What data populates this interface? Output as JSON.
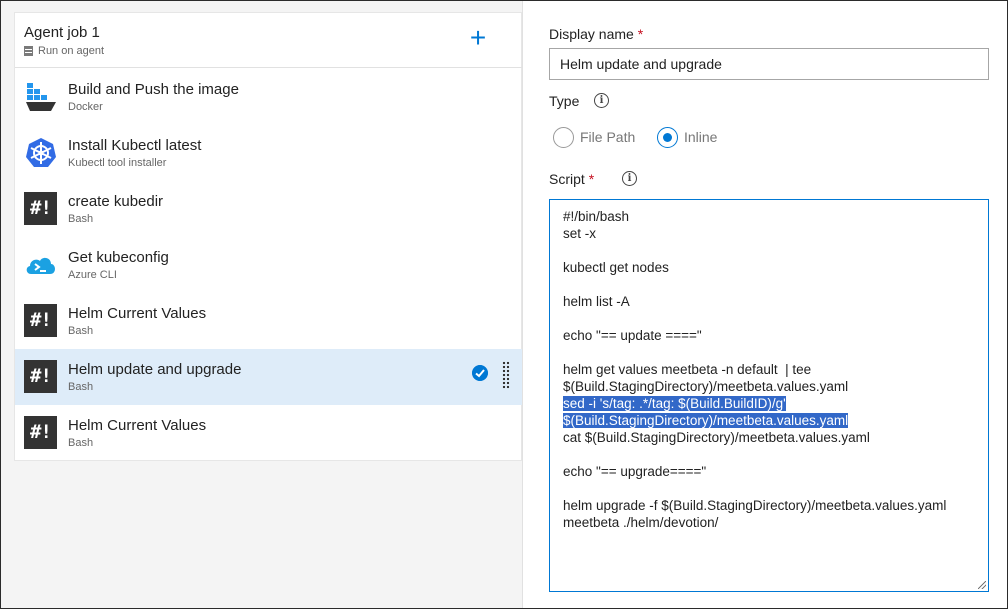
{
  "job": {
    "title": "Agent job 1",
    "subtitle": "Run on agent",
    "add_label": "+"
  },
  "tasks": [
    {
      "title": "Build and Push the image",
      "subtitle": "Docker",
      "icon": "docker-icon"
    },
    {
      "title": "Install Kubectl latest",
      "subtitle": "Kubectl tool installer",
      "icon": "kubernetes-icon"
    },
    {
      "title": "create kubedir",
      "subtitle": "Bash",
      "icon": "bash-icon"
    },
    {
      "title": "Get kubeconfig",
      "subtitle": "Azure CLI",
      "icon": "azure-cli-icon"
    },
    {
      "title": "Helm Current Values",
      "subtitle": "Bash",
      "icon": "bash-icon"
    },
    {
      "title": "Helm update and upgrade",
      "subtitle": "Bash",
      "icon": "bash-icon",
      "selected": true
    },
    {
      "title": "Helm Current Values",
      "subtitle": "Bash",
      "icon": "bash-icon"
    }
  ],
  "bash_glyph": "#!",
  "form": {
    "display_name_label": "Display name",
    "required_mark": "*",
    "display_name_value": "Helm update and upgrade",
    "type_label": "Type",
    "info_glyph": "i",
    "type_options": [
      "File Path",
      "Inline"
    ],
    "type_selected": "Inline",
    "script_label": "Script",
    "script_lines": [
      "#!/bin/bash",
      "set -x",
      "",
      "kubectl get nodes",
      "",
      "helm list -A",
      "",
      "echo \"== update ====\"",
      "",
      "helm get values meetbeta -n default  | tee",
      "$(Build.StagingDirectory)/meetbeta.values.yaml",
      "sed -i 's/tag: .*/tag: $(Build.BuildID)/g'",
      "$(Build.StagingDirectory)/meetbeta.values.yaml",
      "cat $(Build.StagingDirectory)/meetbeta.values.yaml",
      "",
      "echo \"== upgrade====\"",
      "",
      "helm upgrade -f $(Build.StagingDirectory)/meetbeta.values.yaml",
      "meetbeta ./helm/devotion/"
    ],
    "selected_lines": [
      11,
      12
    ]
  },
  "colors": {
    "accent": "#0078d4",
    "selected_row": "#deecf9",
    "selection": "#3268c8",
    "required": "#c50f1f"
  }
}
